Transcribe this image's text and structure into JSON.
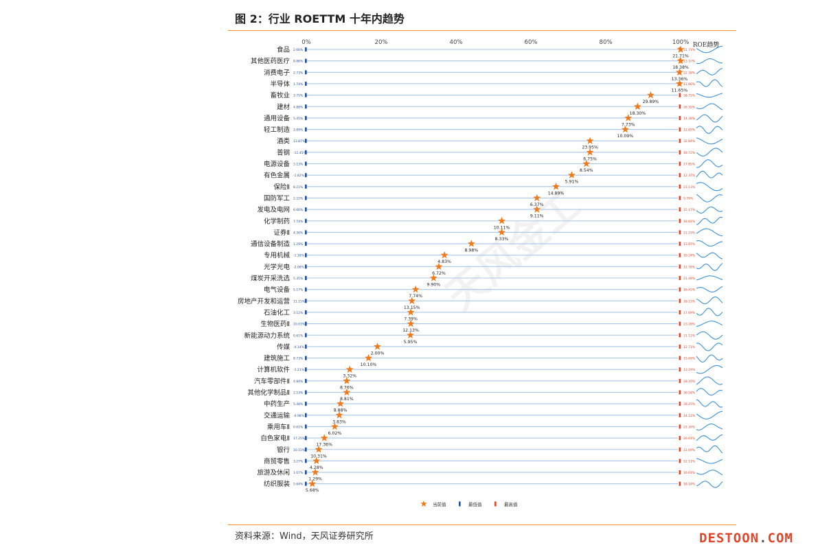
{
  "header": {
    "title": "图 2：行业 ROETTM 十年内趋势"
  },
  "footer": {
    "source": "资料来源：Wind，天风证券研究所"
  },
  "watermark": {
    "brand": "DESTOON",
    "dot": ".",
    "suffix": "COM",
    "overlay_text": "天风金工"
  },
  "colors": {
    "accent": "#f08a2a",
    "star": "#f07a1a",
    "min_bar": "#1f4e9c",
    "max_bar": "#e0462b",
    "trend": "#3b8fd6",
    "row_line": "#a9c4e6"
  },
  "chart_data": {
    "type": "scatter",
    "title": "",
    "trend_header": "ROE趋势",
    "xlim": [
      0,
      100
    ],
    "x_ticks": [
      "0%",
      "20%",
      "40%",
      "60%",
      "80%",
      "100%"
    ],
    "legend": {
      "position": "bottom",
      "items": [
        {
          "name": "当前值",
          "marker": "star"
        },
        {
          "name": "最低值",
          "marker": "blue-bar"
        },
        {
          "name": "最高值",
          "marker": "red-bar"
        }
      ]
    },
    "rows": [
      {
        "name": "食品",
        "min": "2.66%",
        "max": "31.71%",
        "pct": 100,
        "current": "21.71%"
      },
      {
        "name": "其他医药医疗",
        "min": "8.86%",
        "max": "23.10%",
        "pct": 100,
        "current": "18.38%"
      },
      {
        "name": "消费电子",
        "min": "2.73%",
        "max": "22.38%",
        "pct": 99.7,
        "current": "13.36%"
      },
      {
        "name": "半导体",
        "min": "1.74%",
        "max": "11.66%",
        "pct": 99.7,
        "current": "11.65%"
      },
      {
        "name": "畜牧业",
        "min": "3.75%",
        "max": "38.75%",
        "pct": 92,
        "current": "29.89%"
      },
      {
        "name": "建材",
        "min": "4.88%",
        "max": "26.35%",
        "pct": 88.5,
        "current": "18.30%"
      },
      {
        "name": "通用设备",
        "min": "5.45%",
        "max": "14.38%",
        "pct": 86,
        "current": "7.73%"
      },
      {
        "name": "轻工制造",
        "min": "3.89%",
        "max": "12.05%",
        "pct": 85.2,
        "current": "10.09%"
      },
      {
        "name": "酒类",
        "min": "13.87%",
        "max": "32.84%",
        "pct": 75.8,
        "current": "23.95%"
      },
      {
        "name": "普钢",
        "min": "-11.45%",
        "max": "18.72%",
        "pct": 75.8,
        "current": "6.75%"
      },
      {
        "name": "电源设备",
        "min": "3.13%",
        "max": "17.85%",
        "pct": 74.8,
        "current": "8.54%"
      },
      {
        "name": "有色金属",
        "min": "-1.82%",
        "max": "12.37%",
        "pct": 70.9,
        "current": "5.91%"
      },
      {
        "name": "保险Ⅱ",
        "min": "8.21%",
        "max": "23.13%",
        "pct": 66.7,
        "current": "14.89%"
      },
      {
        "name": "国防军工",
        "min": "2.22%",
        "max": "9.79%",
        "pct": 61.6,
        "current": "6.37%"
      },
      {
        "name": "发电及电网",
        "min": "6.66%",
        "max": "15.17%",
        "pct": 61.6,
        "current": "9.11%"
      },
      {
        "name": "化学制药",
        "min": "7.74%",
        "max": "18.02%",
        "pct": 52.2,
        "current": "10.11%"
      },
      {
        "name": "证券Ⅱ",
        "min": "4.36%",
        "max": "21.19%",
        "pct": 52.2,
        "current": "8.33%"
      },
      {
        "name": "通信设备制造",
        "min": "1.29%",
        "max": "13.87%",
        "pct": 44.1,
        "current": "8.98%"
      },
      {
        "name": "专用机械",
        "min": "-1.16%",
        "max": "10.24%",
        "pct": 36.9,
        "current": "4.83%"
      },
      {
        "name": "光学光电",
        "min": "-2.06%",
        "max": "12.78%",
        "pct": 35.4,
        "current": "6.72%"
      },
      {
        "name": "煤炭开采洗选",
        "min": "5.35%",
        "max": "21.48%",
        "pct": 34,
        "current": "9.90%"
      },
      {
        "name": "电气设备",
        "min": "5.17%",
        "max": "16.45%",
        "pct": 29.2,
        "current": "7.74%"
      },
      {
        "name": "房地产开发和运营",
        "min": "11.15%",
        "max": "18.23%",
        "pct": 28.2,
        "current": "13.15%"
      },
      {
        "name": "石油化工",
        "min": "3.12%",
        "max": "17.09%",
        "pct": 27.9,
        "current": "7.39%"
      },
      {
        "name": "生物医药Ⅱ",
        "min": "10.03%",
        "max": "23.28%",
        "pct": 27.9,
        "current": "12.13%"
      },
      {
        "name": "新能源动力系统",
        "min": "0.61%",
        "max": "31.12%",
        "pct": 27.8,
        "current": "5.95%"
      },
      {
        "name": "传媒",
        "min": "-4.14%",
        "max": "12.71%",
        "pct": 19,
        "current": "2.00%"
      },
      {
        "name": "建筑施工",
        "min": "8.73%",
        "max": "15.69%",
        "pct": 16.6,
        "current": "10.10%"
      },
      {
        "name": "计算机软件",
        "min": "-1.21%",
        "max": "13.29%",
        "pct": 11.6,
        "current": "3.32%"
      },
      {
        "name": "汽车零部件Ⅱ",
        "min": "4.84%",
        "max": "28.20%",
        "pct": 10.8,
        "current": "8.76%"
      },
      {
        "name": "其他化学制品Ⅱ",
        "min": "2.53%",
        "max": "36.58%",
        "pct": 10.8,
        "current": "8.81%"
      },
      {
        "name": "中药生产",
        "min": "5.48%",
        "max": "38.25%",
        "pct": 9.1,
        "current": "8.88%"
      },
      {
        "name": "交通运输",
        "min": "-0.98%",
        "max": "14.12%",
        "pct": 8.8,
        "current": "3.83%"
      },
      {
        "name": "乘用车Ⅱ",
        "min": "0.61%",
        "max": "22.30%",
        "pct": 7.6,
        "current": "6.02%"
      },
      {
        "name": "白色家电Ⅱ",
        "min": "17.25%",
        "max": "26.01%",
        "pct": 4.8,
        "current": "17.36%"
      },
      {
        "name": "银行",
        "min": "10.15%",
        "max": "22.09%",
        "pct": 3.3,
        "current": "10.31%"
      },
      {
        "name": "商贸零售",
        "min": "3.27%",
        "max": "12.11%",
        "pct": 2.7,
        "current": "4.28%"
      },
      {
        "name": "旅游及休闲",
        "min": "1.07%",
        "max": "16.01%",
        "pct": 2.4,
        "current": "1.29%"
      },
      {
        "name": "纺织服装",
        "min": "5.64%",
        "max": "18.18%",
        "pct": 1.6,
        "current": "5.68%"
      }
    ]
  }
}
